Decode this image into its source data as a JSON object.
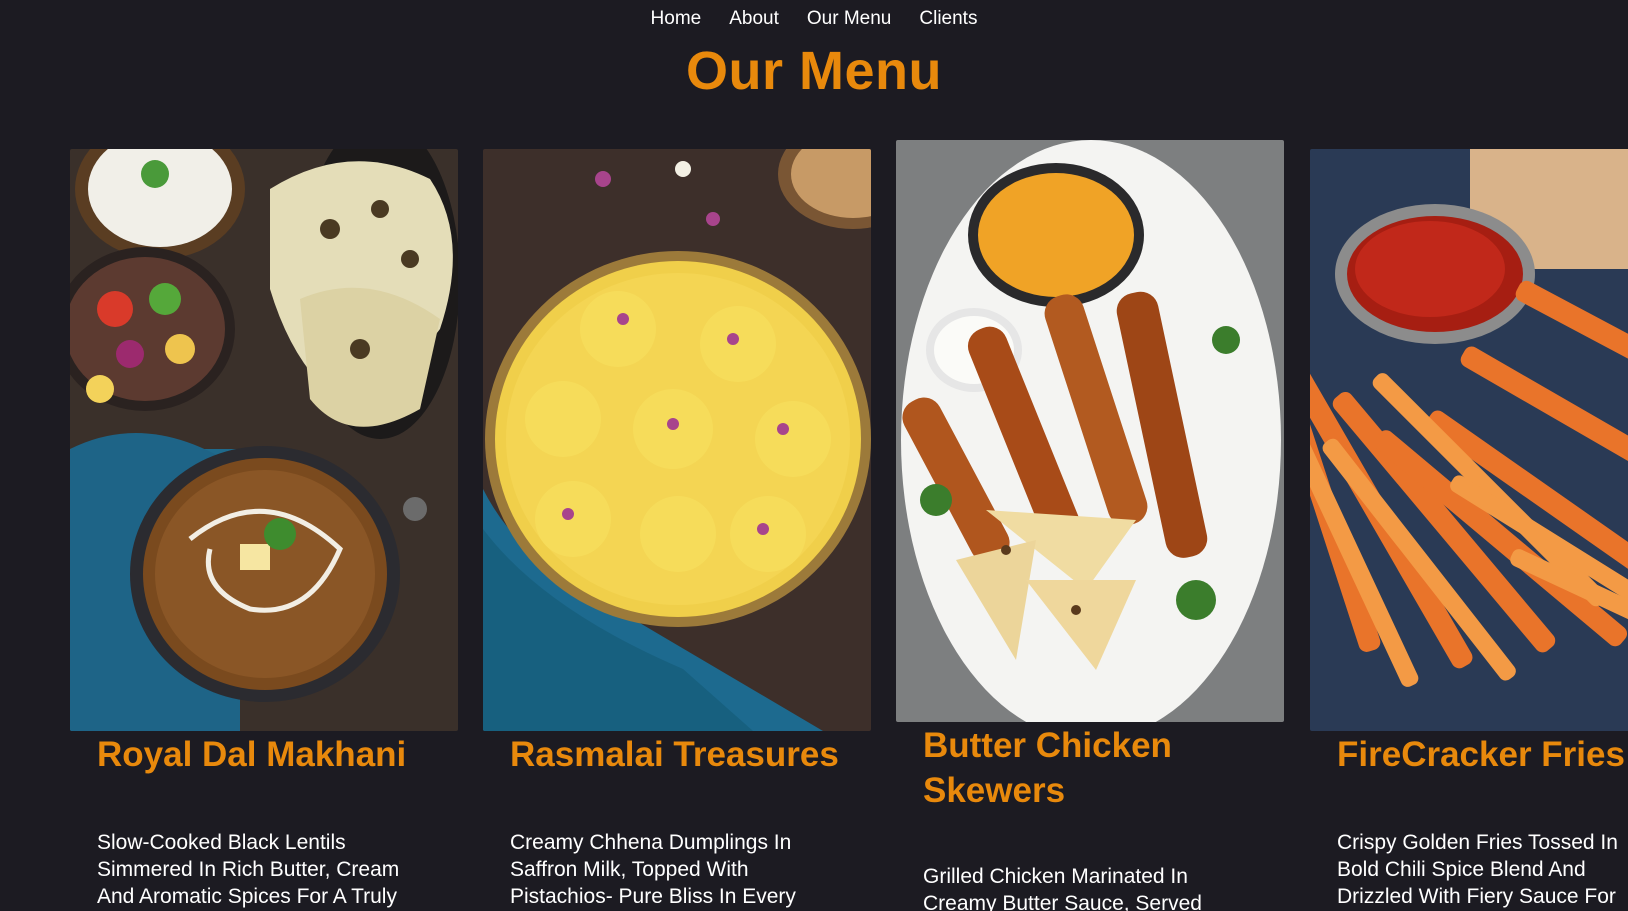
{
  "nav": {
    "items": [
      {
        "label": "Home"
      },
      {
        "label": "About"
      },
      {
        "label": "Our Menu"
      },
      {
        "label": "Clients"
      }
    ]
  },
  "page_title": "Our Menu",
  "colors": {
    "background": "#1c1b22",
    "accent": "#e8890c",
    "text": "#ffffff"
  },
  "menu": {
    "items": [
      {
        "title": "Royal Dal Makhani",
        "description": "Slow-Cooked Black Lentils Simmered In Rich Butter, Cream And Aromatic Spices For A Truly",
        "image": "dal-makhani-photo"
      },
      {
        "title": "Rasmalai Treasures",
        "description": "Creamy Chhena Dumplings In Saffron Milk, Topped With Pistachios- Pure Bliss In Every",
        "image": "rasmalai-photo"
      },
      {
        "title": "Butter Chicken Skewers",
        "description": "Grilled Chicken Marinated In Creamy Butter Sauce, Served",
        "image": "chicken-skewers-photo"
      },
      {
        "title": "FireCracker Fries",
        "description": "Crispy Golden Fries Tossed In Bold Chili Spice Blend And Drizzled With Fiery Sauce For",
        "image": "fries-photo"
      }
    ]
  }
}
